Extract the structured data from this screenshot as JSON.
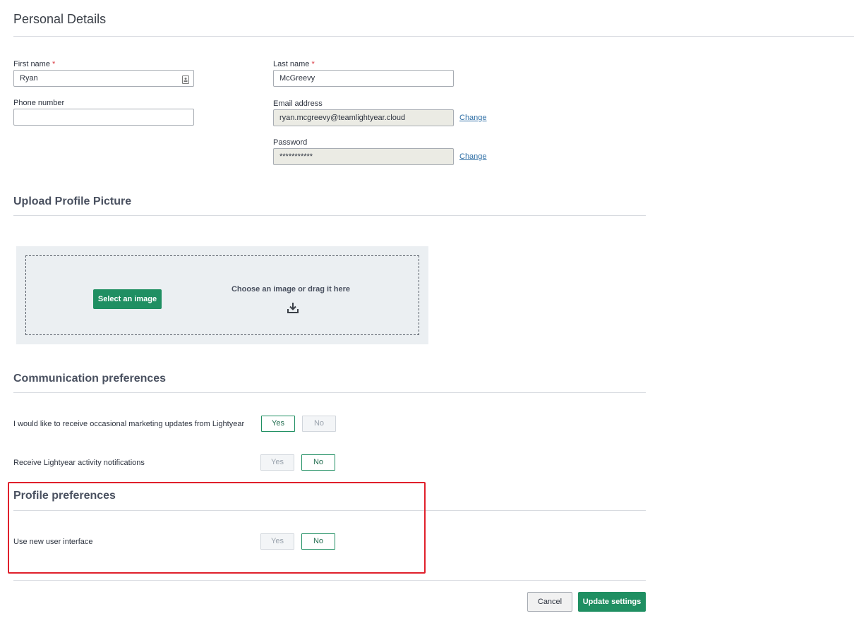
{
  "page_title": "Personal Details",
  "fields": {
    "first_name": {
      "label": "First name",
      "required_mark": "*",
      "value": "Ryan",
      "icon": "contact-card-icon"
    },
    "last_name": {
      "label": "Last name",
      "required_mark": "*",
      "value": "McGreevy"
    },
    "phone": {
      "label": "Phone number",
      "value": ""
    },
    "email": {
      "label": "Email address",
      "value": "ryan.mcgreevy@teamlightyear.cloud",
      "change_label": "Change"
    },
    "password": {
      "label": "Password",
      "value": "***********",
      "change_label": "Change"
    }
  },
  "upload": {
    "title": "Upload Profile Picture",
    "select_button": "Select an image",
    "drop_text": "Choose an image or drag it here",
    "icon": "download-tray-icon"
  },
  "communication": {
    "title": "Communication preferences",
    "items": [
      {
        "label": "I would like to receive occasional marketing updates from Lightyear",
        "yes": "Yes",
        "no": "No",
        "selected": "Yes"
      },
      {
        "label": "Receive Lightyear activity notifications",
        "yes": "Yes",
        "no": "No",
        "selected": "No"
      }
    ]
  },
  "profile": {
    "title": "Profile preferences",
    "items": [
      {
        "label": "Use new user interface",
        "yes": "Yes",
        "no": "No",
        "selected": "No"
      }
    ]
  },
  "footer": {
    "cancel_label": "Cancel",
    "update_label": "Update settings"
  },
  "colors": {
    "accent_green": "#1f8f62",
    "highlight_red": "#e0202b",
    "link_blue": "#2f6fa6"
  }
}
